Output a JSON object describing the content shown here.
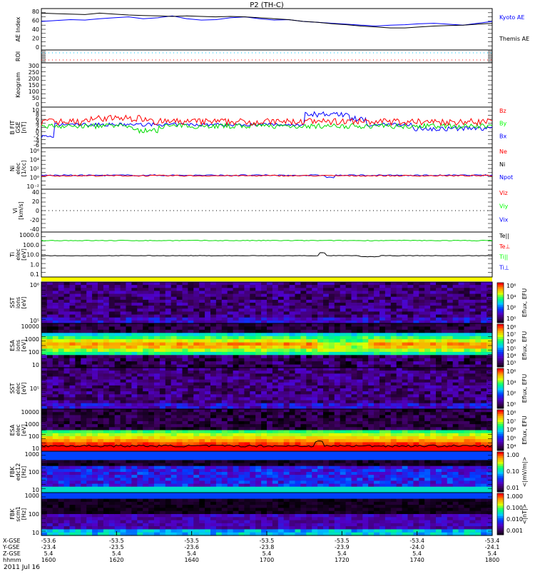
{
  "chart_data": {
    "type": "multi-panel summary plot",
    "title": "P2 (TH-C)",
    "date_label": "2011 Jul 16",
    "x_axis": {
      "row_labels": [
        "X-GSE",
        "Y-GSE",
        "Z-GSE",
        "hhmm"
      ],
      "columns": [
        {
          "x": "-53.6",
          "y": "-23.4",
          "z": "5.4",
          "t": "1600"
        },
        {
          "x": "-53.5",
          "y": "-23.5",
          "z": "5.4",
          "t": "1620"
        },
        {
          "x": "-53.5",
          "y": "-23.6",
          "z": "5.4",
          "t": "1640"
        },
        {
          "x": "-53.5",
          "y": "-23.8",
          "z": "5.4",
          "t": "1700"
        },
        {
          "x": "-53.5",
          "y": "-23.9",
          "z": "5.4",
          "t": "1720"
        },
        {
          "x": "-53.4",
          "y": "-24.0",
          "z": "5.4",
          "t": "1740"
        },
        {
          "x": "-53.4",
          "y": "-24.1",
          "z": "5.4",
          "t": "1800"
        }
      ]
    },
    "panels": [
      {
        "id": "ae",
        "ylabel": [
          "AE Index"
        ],
        "ylim": [
          -10,
          80
        ],
        "ticks": [
          "80",
          "60",
          "40",
          "20",
          "0"
        ],
        "legend": [
          {
            "label": "Kyoto AE",
            "color": "#0000ff"
          },
          {
            "label": "Themis AE",
            "color": "#000000"
          }
        ],
        "series": [
          {
            "name": "Kyoto AE",
            "color": "#0000ff",
            "values": [
              52,
              54,
              56,
              55,
              58,
              60,
              62,
              58,
              60,
              64,
              58,
              55,
              56,
              60,
              62,
              58,
              55,
              56,
              52,
              50,
              48,
              46,
              44,
              42,
              44,
              45,
              47,
              48,
              46,
              44,
              48,
              52
            ]
          },
          {
            "name": "Themis AE",
            "color": "#000000",
            "values": [
              70,
              69,
              68,
              67,
              70,
              68,
              66,
              65,
              64,
              63,
              64,
              63,
              62,
              63,
              62,
              60,
              58,
              56,
              52,
              50,
              47,
              45,
              42,
              40,
              38,
              38,
              40,
              42,
              43,
              44,
              46,
              48
            ]
          }
        ]
      },
      {
        "id": "roi",
        "ylabel": [
          "ROI"
        ],
        "ticks": []
      },
      {
        "id": "keogram",
        "ylabel": [
          "Keogram"
        ],
        "ylim": [
          0,
          300
        ],
        "ticks": [
          "300",
          "250",
          "200",
          "150",
          "100",
          "50",
          "0"
        ]
      },
      {
        "id": "bfield",
        "ylabel": [
          "B FIT",
          "GSE",
          "[nT]"
        ],
        "ylim": [
          -8,
          10
        ],
        "ticks": [
          "10",
          "8",
          "6",
          "4",
          "2",
          "0",
          "-2",
          "-4",
          "-6"
        ],
        "legend": [
          {
            "label": "Bz",
            "color": "#ff0000"
          },
          {
            "label": "By",
            "color": "#00ff00"
          },
          {
            "label": "Bx",
            "color": "#0000ff"
          }
        ]
      },
      {
        "id": "density",
        "ylabel": [
          "Ni",
          "elec",
          "[1/cc]"
        ],
        "ticks": [
          "10⁶",
          "10⁴",
          "10²",
          "10⁰",
          "10⁻²"
        ],
        "legend": [
          {
            "label": "Ne",
            "color": "#ff0000"
          },
          {
            "label": "Ni",
            "color": "#000000"
          },
          {
            "label": "Npot",
            "color": "#0000ff"
          }
        ]
      },
      {
        "id": "velocity",
        "ylabel": [
          "Vi",
          "[km/s]"
        ],
        "ylim": [
          -50,
          50
        ],
        "ticks": [
          "40",
          "20",
          "0",
          "-20",
          "-40"
        ],
        "legend": [
          {
            "label": "Viz",
            "color": "#ff0000"
          },
          {
            "label": "Viy",
            "color": "#00ff00"
          },
          {
            "label": "Vix",
            "color": "#0000ff"
          }
        ]
      },
      {
        "id": "temperature",
        "ylabel": [
          "Ti",
          "elec",
          "[eV]"
        ],
        "ticks": [
          "1000.0",
          "100.0",
          "10.0",
          "1.0",
          "0.1"
        ],
        "legend": [
          {
            "label": "Te||",
            "color": "#000000"
          },
          {
            "label": "Te⊥",
            "color": "#ff0000"
          },
          {
            "label": "Ti||",
            "color": "#00ff00"
          },
          {
            "label": "Ti⊥",
            "color": "#0000ff"
          }
        ]
      },
      {
        "id": "sst-ions",
        "ylabel": [
          "SST",
          "ions",
          "[eV]"
        ],
        "ticks": [
          "10⁶",
          "10⁵"
        ],
        "colorbar": {
          "ticks": [
            "10⁶",
            "10⁴",
            "10²",
            "10⁰"
          ],
          "label": "Eflux, EFU"
        }
      },
      {
        "id": "esa-ions",
        "ylabel": [
          "ESA",
          "ions",
          "[eV]"
        ],
        "ticks": [
          "10000",
          "1000",
          "100",
          "10"
        ],
        "colorbar": {
          "ticks": [
            "10⁸",
            "10⁷",
            "10⁶",
            "10⁵",
            "10⁴",
            "10³"
          ],
          "label": "Eflux, EFU"
        }
      },
      {
        "id": "sst-elec",
        "ylabel": [
          "SST",
          "elec",
          "[eV]"
        ],
        "ticks": [
          "10⁵"
        ],
        "colorbar": {
          "ticks": [
            "10⁶",
            "10⁴",
            "10²",
            "10⁰"
          ],
          "label": "Eflux, EFU"
        }
      },
      {
        "id": "esa-elec",
        "ylabel": [
          "ESA",
          "elec",
          "[eV]"
        ],
        "ticks": [
          "10000",
          "1000",
          "100",
          "10"
        ],
        "colorbar": {
          "ticks": [
            "10⁸",
            "10⁷",
            "10⁶",
            "10⁵",
            "10⁴"
          ],
          "label": "Eflux, EFU"
        }
      },
      {
        "id": "fbk-edc12",
        "ylabel": [
          "FBK",
          "edc12",
          "[Hz]"
        ],
        "ticks": [
          "1000",
          "100",
          "10"
        ],
        "colorbar": {
          "ticks": [
            "1.00",
            "0.10",
            "0.01"
          ],
          "label": "<|mV/m|>"
        }
      },
      {
        "id": "fbk-scm1",
        "ylabel": [
          "FBK",
          "scm1",
          "[Hz]"
        ],
        "ticks": [
          "1000",
          "100",
          "10"
        ],
        "colorbar": {
          "ticks": [
            "1.000",
            "0.100",
            "0.010",
            "0.001"
          ],
          "label": "<|nT|>"
        }
      }
    ]
  }
}
